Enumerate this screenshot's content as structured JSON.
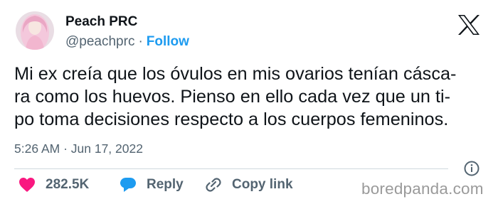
{
  "author": {
    "display_name": "Peach PRC",
    "handle": "@peachprc",
    "separator": "·",
    "follow_label": "Follow"
  },
  "tweet": {
    "lines": [
      "Mi ex creía que los óvulos en mis ovarios tenían cásca-",
      "ra como los huevos. Pienso en ello cada vez que un ti-",
      "po toma decisiones respecto a los cuerpos femeninos."
    ],
    "timestamp": "5:26 AM · Jun 17, 2022"
  },
  "actions": {
    "likes": "282.5K",
    "reply_label": "Reply",
    "copy_label": "Copy link"
  },
  "watermark": "boredpanda.com",
  "colors": {
    "like": "#f91880",
    "reply": "#1d9bf0",
    "link": "#1d9bf0",
    "secondary_text": "#536471"
  },
  "icons": [
    "x-logo-icon",
    "info-icon",
    "heart-icon",
    "reply-bubble-icon",
    "link-icon"
  ]
}
